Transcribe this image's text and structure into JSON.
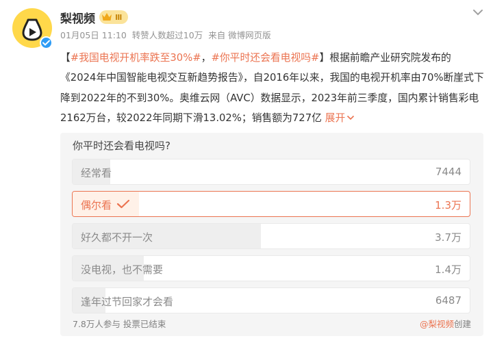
{
  "account": {
    "name": "梨视频",
    "vip_level": "Ⅲ",
    "avatar_icon": "pear-play-logo-icon",
    "verified_icon": "verified-check-icon"
  },
  "meta": {
    "date": "01月05日 11:10",
    "likes": "转赞人数超过10万",
    "source": "来自 微博网页版"
  },
  "post": {
    "bracket_open": "【",
    "hashtag1": "#我国电视开机率跌至30%#",
    "separator": "，",
    "hashtag2": "#你平时还会看电视吗#",
    "bracket_close": "】",
    "body": "根据前瞻产业研究院发布的《2024年中国智能电视交互新趋势报告》，自2016年以来，我国的电视开机率由70%断崖式下降到2022年的不到30%。奥维云网（AVC）数据显示，2023年前三季度，国内累计销售彩电2162万台，较2022年同期下滑13.02%；销售额为727亿",
    "expand_label": "展开",
    "expand_icon": "chevron-down-icon"
  },
  "poll": {
    "question": "你平时还会看电视吗?",
    "options": [
      {
        "label": "经常看",
        "count": "7444",
        "share": 0.095,
        "selected": false
      },
      {
        "label": "偶尔看",
        "count": "1.3万",
        "share": 0.167,
        "selected": true
      },
      {
        "label": "好久都不开一次",
        "count": "3.7万",
        "share": 0.474,
        "selected": false
      },
      {
        "label": "没电视，也不需要",
        "count": "1.4万",
        "share": 0.179,
        "selected": false
      },
      {
        "label": "逢年过节回家才会看",
        "count": "6487",
        "share": 0.083,
        "selected": false
      }
    ],
    "footer": "7.8万人参与 投票已结束",
    "creator_at": "@梨视频",
    "creator_suffix": "创建"
  },
  "colors": {
    "accent": "#eb7350",
    "brand_yellow": "#ffd84a",
    "verified_blue": "#2f9cf5"
  }
}
